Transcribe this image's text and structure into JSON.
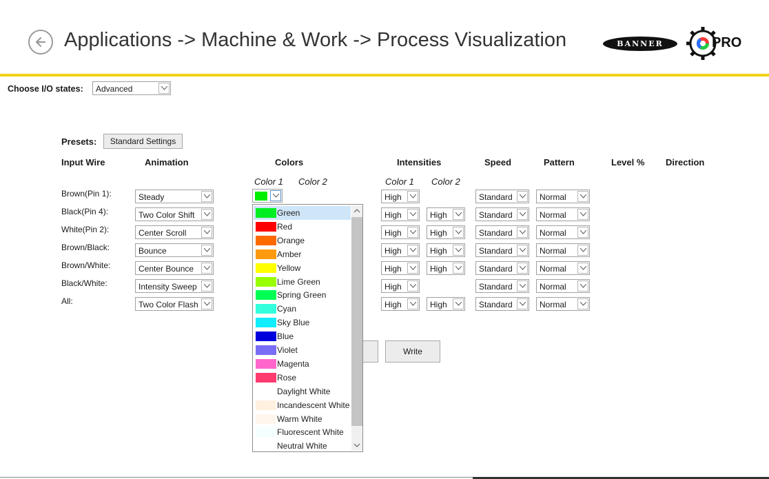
{
  "header": {
    "title": "Applications -> Machine & Work -> Process Visualization",
    "banner_logo": "BANNER",
    "pro_logo": "PRO",
    "accent_color": "#f2d21a"
  },
  "io_states": {
    "label": "Choose I/O states:",
    "value": "Advanced"
  },
  "presets": {
    "label": "Presets:",
    "button": "Standard Settings"
  },
  "columns": {
    "input_wire": "Input Wire",
    "animation": "Animation",
    "colors": "Colors",
    "intensities": "Intensities",
    "speed": "Speed",
    "pattern": "Pattern",
    "level": "Level %",
    "direction": "Direction",
    "color1": "Color 1",
    "color2": "Color 2"
  },
  "rows": [
    {
      "wire": "Brown(Pin 1):",
      "animation": "Steady",
      "int1": "High",
      "int2": "",
      "speed": "Standard",
      "pattern": "Normal"
    },
    {
      "wire": "Black(Pin 4):",
      "animation": "Two Color Shift",
      "int1": "High",
      "int2": "High",
      "speed": "Standard",
      "pattern": "Normal"
    },
    {
      "wire": "White(Pin 2):",
      "animation": "Center Scroll",
      "int1": "High",
      "int2": "High",
      "speed": "Standard",
      "pattern": "Normal"
    },
    {
      "wire": "Brown/Black:",
      "animation": "Bounce",
      "int1": "High",
      "int2": "High",
      "speed": "Standard",
      "pattern": "Normal"
    },
    {
      "wire": "Brown/White:",
      "animation": "Center Bounce",
      "int1": "High",
      "int2": "High",
      "speed": "Standard",
      "pattern": "Normal"
    },
    {
      "wire": "Black/White:",
      "animation": "Intensity Sweep",
      "int1": "High",
      "int2": "",
      "speed": "Standard",
      "pattern": "Normal"
    },
    {
      "wire": "All:",
      "animation": "Two Color Flash",
      "int1": "High",
      "int2": "High",
      "speed": "Standard",
      "pattern": "Normal"
    }
  ],
  "color1_selected_swatch": "#00ee00",
  "write_button": "Write",
  "color_dropdown": {
    "selected": "Green",
    "options": [
      {
        "name": "Green",
        "color": "#00ee22"
      },
      {
        "name": "Red",
        "color": "#ff0000"
      },
      {
        "name": "Orange",
        "color": "#ff6a00"
      },
      {
        "name": "Amber",
        "color": "#ff9a10"
      },
      {
        "name": "Yellow",
        "color": "#ffff00"
      },
      {
        "name": "Lime Green",
        "color": "#99ff00"
      },
      {
        "name": "Spring Green",
        "color": "#00ff55"
      },
      {
        "name": "Cyan",
        "color": "#33ffdd"
      },
      {
        "name": "Sky Blue",
        "color": "#11eeff"
      },
      {
        "name": "Blue",
        "color": "#0000dd"
      },
      {
        "name": "Violet",
        "color": "#7a6df5"
      },
      {
        "name": "Magenta",
        "color": "#ff66cc"
      },
      {
        "name": "Rose",
        "color": "#ff3a6e"
      },
      {
        "name": "Daylight White",
        "color": "#ffffff"
      },
      {
        "name": "Incandescent White",
        "color": "#fff0e0"
      },
      {
        "name": "Warm White",
        "color": "#fff7ee"
      },
      {
        "name": "Fluorescent White",
        "color": "#f4ffff"
      },
      {
        "name": "Neutral White",
        "color": "#ffffff"
      }
    ]
  }
}
